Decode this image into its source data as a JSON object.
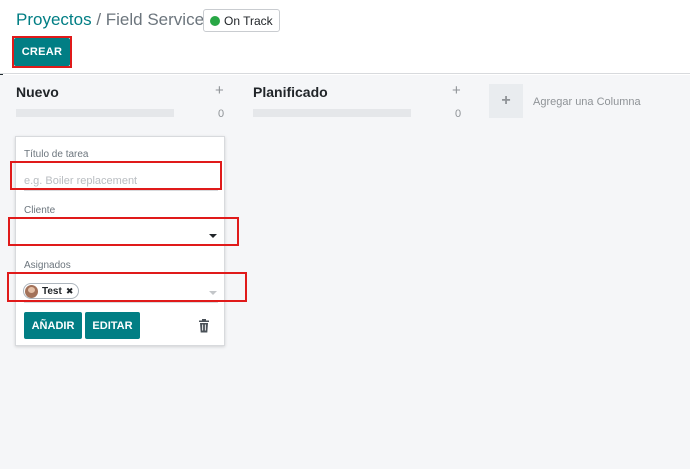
{
  "breadcrumb": {
    "parent": "Proyectos",
    "separator": " / ",
    "current": "Field Service"
  },
  "status": {
    "label": "On Track",
    "color": "#28a745"
  },
  "toolbar": {
    "create_label": "CREAR"
  },
  "columns": [
    {
      "title": "Nuevo",
      "count": "0",
      "add_symbol": "+"
    },
    {
      "title": "Planificado",
      "count": "0",
      "add_symbol": "+"
    }
  ],
  "add_column": {
    "symbol": "+",
    "label": "Agregar una Columna"
  },
  "quick_create": {
    "title_label": "Título de tarea",
    "title_placeholder": "e.g. Boiler replacement",
    "client_label": "Cliente",
    "client_value": "",
    "assignees_label": "Asignados",
    "assignee_tags": [
      {
        "name": "Test",
        "remove_symbol": "✖"
      }
    ],
    "add_label": "AÑADIR",
    "edit_label": "EDITAR"
  },
  "colors": {
    "primary": "#017e84",
    "highlight": "#e01a1a",
    "icon_names": [
      "plus-icon",
      "caret-down-icon",
      "trash-icon",
      "status-dot-icon"
    ]
  }
}
